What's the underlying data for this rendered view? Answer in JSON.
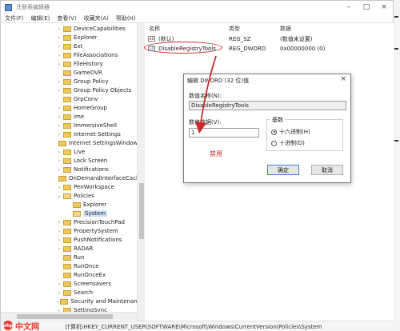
{
  "window": {
    "title": "注册表编辑器",
    "menu": [
      "文件(F)",
      "编辑(E)",
      "查看(V)",
      "收藏夹(A)",
      "帮助(H)"
    ]
  },
  "tree": {
    "items": [
      {
        "label": "DeviceCapabilities",
        "expander": "›",
        "open": false
      },
      {
        "label": "Explorer",
        "expander": "›",
        "open": false
      },
      {
        "label": "Ext",
        "expander": "›",
        "open": false
      },
      {
        "label": "FileAssociations",
        "expander": "›",
        "open": false
      },
      {
        "label": "FileHistory",
        "expander": "›",
        "open": false
      },
      {
        "label": "GameDVR",
        "expander": "",
        "open": false
      },
      {
        "label": "Group Policy",
        "expander": "›",
        "open": false
      },
      {
        "label": "Group Policy Objects",
        "expander": "›",
        "open": false
      },
      {
        "label": "GrpConv",
        "expander": "",
        "open": false
      },
      {
        "label": "HomeGroup",
        "expander": "›",
        "open": false
      },
      {
        "label": "ime",
        "expander": "›",
        "open": false
      },
      {
        "label": "ImmersiveShell",
        "expander": "›",
        "open": false
      },
      {
        "label": "Internet Settings",
        "expander": "›",
        "open": false
      },
      {
        "label": "Internet SettingsWindow",
        "expander": "",
        "open": false
      },
      {
        "label": "Live",
        "expander": "›",
        "open": false
      },
      {
        "label": "Lock Screen",
        "expander": "›",
        "open": false
      },
      {
        "label": "Notifications",
        "expander": "›",
        "open": false
      },
      {
        "label": "OnDemandInterfaceCach",
        "expander": "",
        "open": false
      },
      {
        "label": "PenWorkspace",
        "expander": "›",
        "open": false
      },
      {
        "label": "Policies",
        "expander": "⌄",
        "open": true
      },
      {
        "label": "Explorer",
        "expander": "",
        "open": false,
        "child": true
      },
      {
        "label": "System",
        "expander": "",
        "open": true,
        "child": true,
        "selected": true
      },
      {
        "label": "PrecisionTouchPad",
        "expander": "›",
        "open": false
      },
      {
        "label": "PropertySystem",
        "expander": "›",
        "open": false
      },
      {
        "label": "PushNotifications",
        "expander": "›",
        "open": false
      },
      {
        "label": "RADAR",
        "expander": "›",
        "open": false
      },
      {
        "label": "Run",
        "expander": "",
        "open": false
      },
      {
        "label": "RunOnce",
        "expander": "",
        "open": false
      },
      {
        "label": "RunOnceEx",
        "expander": "",
        "open": false
      },
      {
        "label": "Screensavers",
        "expander": "›",
        "open": false
      },
      {
        "label": "Search",
        "expander": "›",
        "open": false
      },
      {
        "label": "Security and Maintenanc",
        "expander": "›",
        "open": false
      },
      {
        "label": "SettingSync",
        "expander": "›",
        "open": false
      }
    ]
  },
  "values": {
    "headers": {
      "name": "名称",
      "type": "类型",
      "data": "数据"
    },
    "rows": [
      {
        "name": "(默认)",
        "type": "REG_SZ",
        "data": "(数值未设置)",
        "icon": "ab"
      },
      {
        "name": "DisableRegistryTools",
        "type": "REG_DWORD",
        "data": "0x00000000 (0)",
        "icon": "10"
      }
    ]
  },
  "statusbar": {
    "path": "计算机\\HKEY_CURRENT_USER\\SOFTWARE\\Microsoft\\Windows\\CurrentVersion\\Policies\\System"
  },
  "watermark": {
    "logo": "php",
    "text": "中文网"
  },
  "dialog": {
    "title": "编辑 DWORD (32 位)值",
    "close": "×",
    "name_label": "数值名称(N):",
    "name_value": "DisableRegistryTools",
    "data_label": "数值数据(V):",
    "data_value": "1",
    "base_label": "基数",
    "hex_label": "十六进制(H)",
    "dec_label": "十进制(D)",
    "ok": "确定",
    "cancel": "取消",
    "annotation": "禁用"
  },
  "colors": {
    "annotation": "#c92a2a",
    "folder": "#f0c75c",
    "selected": "#cfe3f7"
  }
}
